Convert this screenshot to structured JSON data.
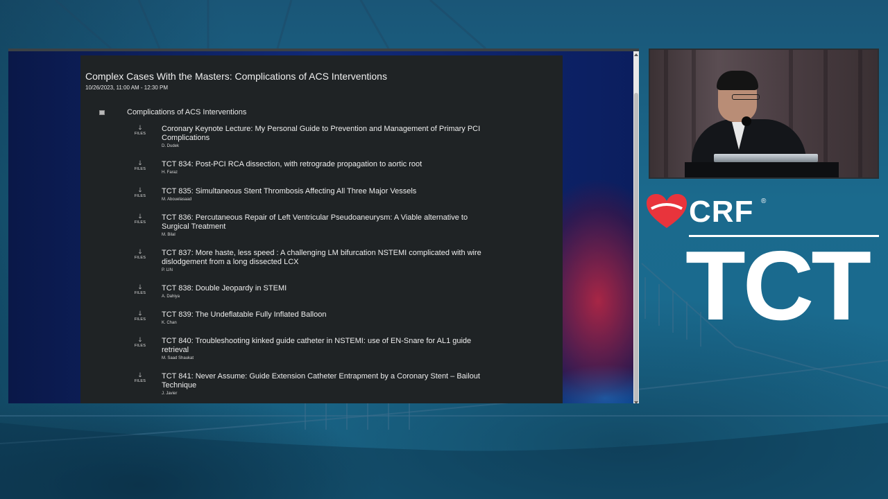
{
  "session": {
    "title": "Complex Cases With the Masters: Complications of ACS Interventions",
    "datetime": "10/26/2023, 11:00 AM - 12:30 PM"
  },
  "group": {
    "label": "Complications of ACS Interventions",
    "icon": "collapse-icon"
  },
  "files_label": "FILES",
  "files_arrow": "🡓",
  "items": [
    {
      "title": "Coronary Keynote Lecture: My Personal Guide to Prevention and Management of Primary PCI Complications",
      "author": "D. Dudek"
    },
    {
      "title": "TCT 834: Post-PCI RCA dissection, with retrograde propagation to aortic root",
      "author": "H. Faraz"
    },
    {
      "title": "TCT 835: Simultaneous Stent Thrombosis Affecting All Three Major Vessels",
      "author": "M. Abouelasaad"
    },
    {
      "title": "TCT 836: Percutaneous Repair of Left Ventricular Pseudoaneurysm: A Viable alternative to Surgical Treatment",
      "author": "M. Bilal"
    },
    {
      "title": "TCT 837: More haste, less speed : A challenging LM bifurcation NSTEMI complicated with wire dislodgement from a long dissected LCX",
      "author": "P. LIN"
    },
    {
      "title": "TCT 838: Double Jeopardy in STEMI",
      "author": "A. Dahiya"
    },
    {
      "title": "TCT 839: The Undeflatable Fully Inflated Balloon",
      "author": "K. Chan"
    },
    {
      "title": "TCT 840: Troubleshooting kinked guide catheter in NSTEMI: use of EN-Snare for AL1 guide retrieval",
      "author": "M. Saad Shaukat"
    },
    {
      "title": "TCT 841: Never Assume: Guide Extension Catheter Entrapment by a Coronary Stent – Bailout Technique",
      "author": "J. Javier"
    }
  ],
  "branding": {
    "crf": "CRF",
    "registered": "®",
    "tct": "TCT",
    "heart_color": "#e8343c"
  }
}
